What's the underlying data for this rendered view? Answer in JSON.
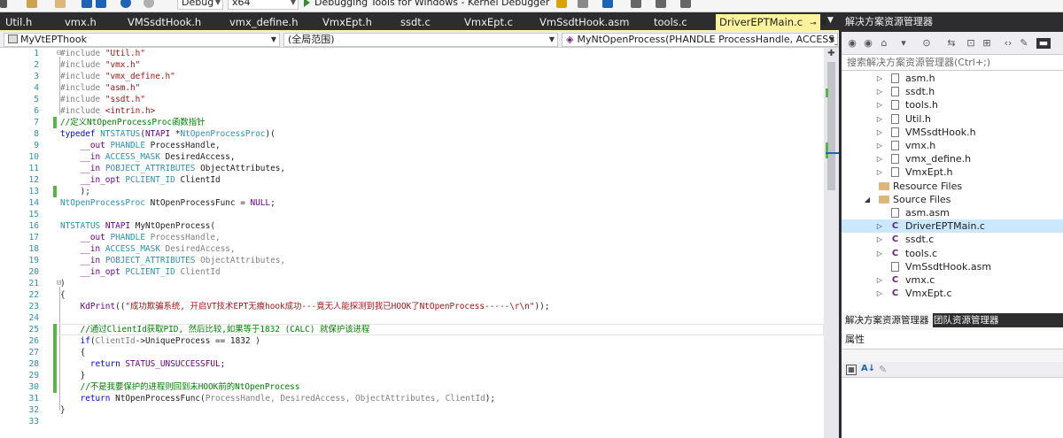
{
  "toolbar": {
    "config_value": "Debug",
    "platform_value": "x64",
    "debugger_label": "Debugging Tools for Windows - Kernel Debugger"
  },
  "tabs": [
    {
      "label": "Util.h"
    },
    {
      "label": "vmx.h"
    },
    {
      "label": "VMSsdtHook.h"
    },
    {
      "label": "vmx_define.h"
    },
    {
      "label": "VmxEpt.h"
    },
    {
      "label": "ssdt.c"
    },
    {
      "label": "VmxEpt.c"
    },
    {
      "label": "VmSsdtHook.asm"
    },
    {
      "label": "tools.c"
    },
    {
      "label": "DriverEPTMain.c"
    }
  ],
  "navbar": {
    "project": "MyVtEPThook",
    "scope": "(全局范围)",
    "member": "MyNtOpenProcess(PHANDLE ProcessHandle, ACCESS_MAS"
  },
  "editor": {
    "line_numbers": [
      "1",
      "2",
      "3",
      "4",
      "5",
      "6",
      "7",
      "8",
      "9",
      "10",
      "11",
      "12",
      "13",
      "14",
      "15",
      "16",
      "17",
      "18",
      "19",
      "20",
      "21",
      "22",
      "23",
      "24",
      "25",
      "26",
      "27",
      "28",
      "29",
      "30",
      "31",
      "32",
      "33"
    ],
    "lines": [
      [
        {
          "t": "#include ",
          "c": "pp"
        },
        {
          "t": "\"Util.h\"",
          "c": "str"
        }
      ],
      [
        {
          "t": "#include ",
          "c": "pp"
        },
        {
          "t": "\"vmx.h\"",
          "c": "str"
        }
      ],
      [
        {
          "t": "#include ",
          "c": "pp"
        },
        {
          "t": "\"vmx_define.h\"",
          "c": "str"
        }
      ],
      [
        {
          "t": "#include ",
          "c": "pp"
        },
        {
          "t": "\"asm.h\"",
          "c": "str"
        }
      ],
      [
        {
          "t": "#include ",
          "c": "pp"
        },
        {
          "t": "\"ssdt.h\"",
          "c": "str"
        }
      ],
      [
        {
          "t": "#include ",
          "c": "pp"
        },
        {
          "t": "<intrin.h>",
          "c": "str"
        }
      ],
      [
        {
          "t": "//定义NtOpenProcessProc函数指针",
          "c": "cm"
        }
      ],
      [
        {
          "t": "typedef ",
          "c": "kw"
        },
        {
          "t": "NTSTATUS",
          "c": "ty"
        },
        {
          "t": "(",
          "c": "fn"
        },
        {
          "t": "NTAPI",
          "c": "mac"
        },
        {
          "t": " *",
          "c": "fn"
        },
        {
          "t": "NtOpenProcessProc",
          "c": "ty"
        },
        {
          "t": ")(",
          "c": "fn"
        }
      ],
      [
        {
          "t": "    __out ",
          "c": "mac"
        },
        {
          "t": "PHANDLE",
          "c": "ty"
        },
        {
          "t": " ProcessHandle,",
          "c": "fn"
        }
      ],
      [
        {
          "t": "    __in ",
          "c": "mac"
        },
        {
          "t": "ACCESS_MASK",
          "c": "ty"
        },
        {
          "t": " DesiredAccess,",
          "c": "fn"
        }
      ],
      [
        {
          "t": "    __in ",
          "c": "mac"
        },
        {
          "t": "POBJECT_ATTRIBUTES",
          "c": "ty"
        },
        {
          "t": " ObjectAttributes,",
          "c": "fn"
        }
      ],
      [
        {
          "t": "    __in_opt ",
          "c": "mac"
        },
        {
          "t": "PCLIENT_ID",
          "c": "ty"
        },
        {
          "t": " ClientId",
          "c": "fn"
        }
      ],
      [
        {
          "t": "    );",
          "c": "fn"
        }
      ],
      [
        {
          "t": "NtOpenProcessProc",
          "c": "ty"
        },
        {
          "t": " NtOpenProcessFunc = ",
          "c": "fn"
        },
        {
          "t": "NULL",
          "c": "mac"
        },
        {
          "t": ";",
          "c": "fn"
        }
      ],
      [],
      [
        {
          "t": "NTSTATUS ",
          "c": "ty"
        },
        {
          "t": "NTAPI",
          "c": "mac"
        },
        {
          "t": " MyNtOpenProcess(",
          "c": "fn"
        }
      ],
      [
        {
          "t": "    __out ",
          "c": "mac"
        },
        {
          "t": "PHANDLE",
          "c": "ty"
        },
        {
          "t": " ProcessHandle,",
          "c": "pa"
        }
      ],
      [
        {
          "t": "    __in ",
          "c": "mac"
        },
        {
          "t": "ACCESS_MASK",
          "c": "ty"
        },
        {
          "t": " DesiredAccess,",
          "c": "pa"
        }
      ],
      [
        {
          "t": "    __in ",
          "c": "mac"
        },
        {
          "t": "POBJECT_ATTRIBUTES",
          "c": "ty"
        },
        {
          "t": " ObjectAttributes,",
          "c": "pa"
        }
      ],
      [
        {
          "t": "    __in_opt ",
          "c": "mac"
        },
        {
          "t": "PCLIENT_ID",
          "c": "ty"
        },
        {
          "t": " ClientId",
          "c": "pa"
        }
      ],
      [
        {
          "t": ")",
          "c": "fn"
        }
      ],
      [
        {
          "t": "{",
          "c": "fn"
        }
      ],
      [
        {
          "t": "    KdPrint",
          "c": "mac"
        },
        {
          "t": "((",
          "c": "fn"
        },
        {
          "t": "\"成功欺骗系统, 开启VT技术EPT无痕hook成功---竟无人能探测到我已HOOK了NtOpenProcess-----\\r\\n\"",
          "c": "str"
        },
        {
          "t": "));",
          "c": "fn"
        }
      ],
      [],
      [
        {
          "t": "    //通过ClientId获取PID, 然后比较,如果等于1832 (CALC) 就保护该进程",
          "c": "cm"
        }
      ],
      [
        {
          "t": "    ",
          "c": "fn"
        },
        {
          "t": "if",
          "c": "kw"
        },
        {
          "t": "(",
          "c": "fn"
        },
        {
          "t": "ClientId",
          "c": "pa"
        },
        {
          "t": "->UniqueProcess == 1832 )",
          "c": "fn"
        }
      ],
      [
        {
          "t": "    {",
          "c": "fn"
        }
      ],
      [
        {
          "t": "      ",
          "c": "fn"
        },
        {
          "t": "return ",
          "c": "kw"
        },
        {
          "t": "STATUS_UNSUCCESSFUL",
          "c": "mac"
        },
        {
          "t": ";",
          "c": "fn"
        }
      ],
      [
        {
          "t": "    }",
          "c": "fn"
        }
      ],
      [
        {
          "t": "    //不是我要保护的进程则回到未HOOK前的NtOpenProcess",
          "c": "cm"
        }
      ],
      [
        {
          "t": "    ",
          "c": "fn"
        },
        {
          "t": "return ",
          "c": "kw"
        },
        {
          "t": "NtOpenProcessFunc(",
          "c": "fn"
        },
        {
          "t": "ProcessHandle, DesiredAccess, ObjectAttributes, ClientId",
          "c": "pa"
        },
        {
          "t": ");",
          "c": "fn"
        }
      ],
      [
        {
          "t": "}",
          "c": "fn"
        }
      ],
      []
    ]
  },
  "solution_explorer": {
    "title": "解决方案资源管理器",
    "search_placeholder": "搜索解决方案资源管理器(Ctrl+;)",
    "items": [
      {
        "label": "asm.h",
        "kind": "h",
        "depth": 2
      },
      {
        "label": "ssdt.h",
        "kind": "h",
        "depth": 2
      },
      {
        "label": "tools.h",
        "kind": "h",
        "depth": 2
      },
      {
        "label": "Util.h",
        "kind": "h",
        "depth": 2
      },
      {
        "label": "VMSsdtHook.h",
        "kind": "h",
        "depth": 2
      },
      {
        "label": "vmx.h",
        "kind": "h",
        "depth": 2
      },
      {
        "label": "vmx_define.h",
        "kind": "h",
        "depth": 2
      },
      {
        "label": "VmxEpt.h",
        "kind": "h",
        "depth": 2
      },
      {
        "label": "Resource Files",
        "kind": "folder",
        "depth": 1
      },
      {
        "label": "Source Files",
        "kind": "folder-open",
        "depth": 1
      },
      {
        "label": "asm.asm",
        "kind": "asm",
        "depth": 2
      },
      {
        "label": "DriverEPTMain.c",
        "kind": "c",
        "depth": 2,
        "selected": true
      },
      {
        "label": "ssdt.c",
        "kind": "c",
        "depth": 2
      },
      {
        "label": "tools.c",
        "kind": "c",
        "depth": 2
      },
      {
        "label": "VmSsdtHook.asm",
        "kind": "asm",
        "depth": 2
      },
      {
        "label": "vmx.c",
        "kind": "c",
        "depth": 2
      },
      {
        "label": "VmxEpt.c",
        "kind": "c",
        "depth": 2
      }
    ],
    "tabs": [
      "解决方案资源管理器",
      "团队资源管理器"
    ]
  },
  "properties": {
    "title": "属性"
  }
}
